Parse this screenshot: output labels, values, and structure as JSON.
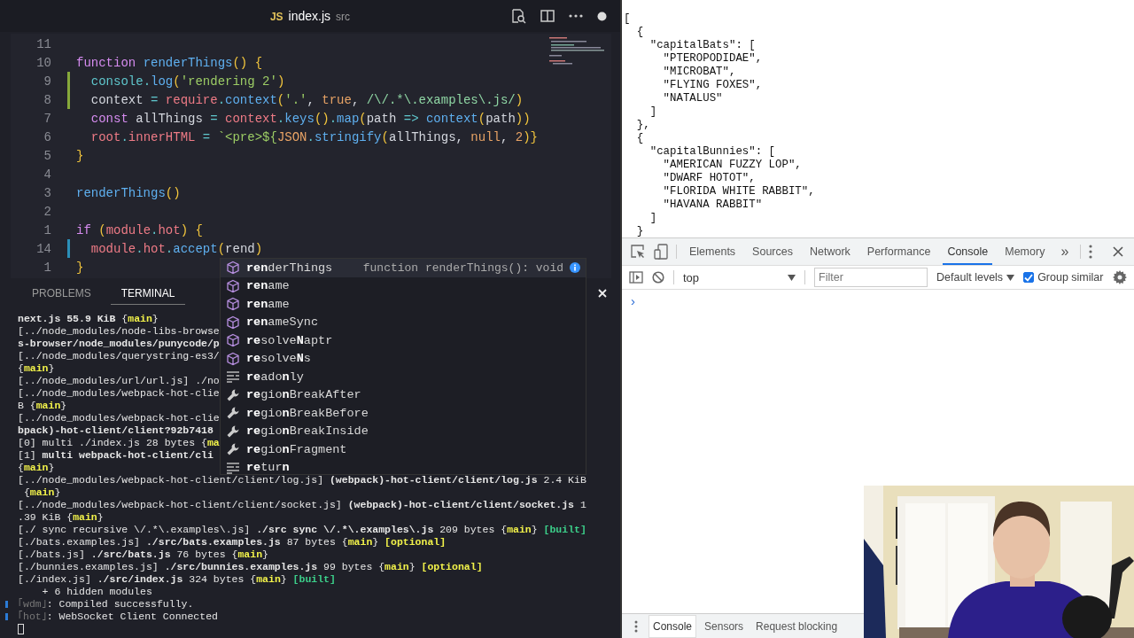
{
  "editor": {
    "tab": {
      "file_icon": "JS",
      "name": "index.js",
      "folder": "src",
      "unsaved": true
    },
    "lines": [
      {
        "number": "11"
      },
      {
        "number": "10",
        "tokens": [
          {
            "kind": "kw",
            "text": "function "
          },
          {
            "kind": "fn",
            "text": "renderThings"
          },
          {
            "kind": "pu",
            "text": "() {"
          }
        ]
      },
      {
        "number": "9",
        "color": "#86a83a",
        "tokens": [
          {
            "kind": "obj",
            "text": "  console"
          },
          {
            "kind": "op",
            "text": "."
          },
          {
            "kind": "me",
            "text": "log"
          },
          {
            "kind": "pu",
            "text": "("
          },
          {
            "kind": "st",
            "text": "'rendering 2'"
          },
          {
            "kind": "pu",
            "text": ")"
          }
        ]
      },
      {
        "number": "8",
        "color": "#86a83a",
        "tokens": [
          {
            "kind": "p",
            "text": "  context "
          },
          {
            "kind": "op",
            "text": "= "
          },
          {
            "kind": "rd",
            "text": "require"
          },
          {
            "kind": "op",
            "text": "."
          },
          {
            "kind": "me",
            "text": "context"
          },
          {
            "kind": "pu",
            "text": "("
          },
          {
            "kind": "st",
            "text": "'.'"
          },
          {
            "kind": "p",
            "text": ", "
          },
          {
            "kind": "nu",
            "text": "true"
          },
          {
            "kind": "p",
            "text": ", "
          },
          {
            "kind": "rx",
            "text": "/\\/.*\\.examples\\.js/"
          },
          {
            "kind": "pu",
            "text": ")"
          }
        ]
      },
      {
        "number": "7",
        "tokens": [
          {
            "kind": "kw",
            "text": "  const"
          },
          {
            "kind": "p",
            "text": " allThings "
          },
          {
            "kind": "op",
            "text": "= "
          },
          {
            "kind": "rd",
            "text": "context"
          },
          {
            "kind": "op",
            "text": "."
          },
          {
            "kind": "me",
            "text": "keys"
          },
          {
            "kind": "pu",
            "text": "()"
          },
          {
            "kind": "op",
            "text": "."
          },
          {
            "kind": "me",
            "text": "map"
          },
          {
            "kind": "pu",
            "text": "("
          },
          {
            "kind": "p",
            "text": "path "
          },
          {
            "kind": "op",
            "text": "=> "
          },
          {
            "kind": "me",
            "text": "context"
          },
          {
            "kind": "pu",
            "text": "("
          },
          {
            "kind": "p",
            "text": "path"
          },
          {
            "kind": "pu",
            "text": "))"
          }
        ]
      },
      {
        "number": "6",
        "tokens": [
          {
            "kind": "rd",
            "text": "  root"
          },
          {
            "kind": "op",
            "text": "."
          },
          {
            "kind": "rd",
            "text": "innerHTML "
          },
          {
            "kind": "op",
            "text": "= "
          },
          {
            "kind": "st",
            "text": "`<pre>${"
          },
          {
            "kind": "nu",
            "text": "JSON"
          },
          {
            "kind": "op",
            "text": "."
          },
          {
            "kind": "me",
            "text": "stringify"
          },
          {
            "kind": "pu",
            "text": "("
          },
          {
            "kind": "p",
            "text": "allThings, "
          },
          {
            "kind": "nu",
            "text": "null"
          },
          {
            "kind": "p",
            "text": ", "
          },
          {
            "kind": "nu",
            "text": "2"
          },
          {
            "kind": "pu",
            "text": ")}"
          }
        ]
      },
      {
        "number": "5",
        "tokens": [
          {
            "kind": "pu",
            "text": "}"
          }
        ]
      },
      {
        "number": "4"
      },
      {
        "number": "3",
        "tokens": [
          {
            "kind": "fn",
            "text": "renderThings"
          },
          {
            "kind": "pu",
            "text": "()"
          }
        ]
      },
      {
        "number": "2"
      },
      {
        "number": "1",
        "tokens": [
          {
            "kind": "kw",
            "text": "if "
          },
          {
            "kind": "pu",
            "text": "("
          },
          {
            "kind": "rd",
            "text": "module"
          },
          {
            "kind": "op",
            "text": "."
          },
          {
            "kind": "rd",
            "text": "hot"
          },
          {
            "kind": "pu",
            "text": ") {"
          }
        ]
      },
      {
        "number": "14",
        "color": "#2b8fb8",
        "tokens": [
          {
            "kind": "rd",
            "text": "  module"
          },
          {
            "kind": "op",
            "text": "."
          },
          {
            "kind": "rd",
            "text": "hot"
          },
          {
            "kind": "op",
            "text": "."
          },
          {
            "kind": "me",
            "text": "accept"
          },
          {
            "kind": "pu",
            "text": "("
          },
          {
            "kind": "p",
            "text": "rend"
          },
          {
            "kind": "pu",
            "text": ")"
          }
        ]
      },
      {
        "number": "1",
        "tokens": [
          {
            "kind": "pu",
            "text": "}"
          }
        ]
      }
    ],
    "suggestions": [
      {
        "kind": "method",
        "label": "**ren**derThings",
        "detail": "function renderThings(): void",
        "selected": true
      },
      {
        "kind": "method",
        "label": "**ren**ame",
        "selected": false
      },
      {
        "kind": "method",
        "label": "**ren**ame",
        "selected": false
      },
      {
        "kind": "method",
        "label": "**ren**ameSync",
        "selected": false
      },
      {
        "kind": "method",
        "label": "**re**solve**N**aptr",
        "selected": false
      },
      {
        "kind": "method",
        "label": "**re**solve**N**s",
        "selected": false
      },
      {
        "kind": "keyword",
        "label": "**re**ado**n**ly",
        "selected": false
      },
      {
        "kind": "property",
        "label": "**re**gio**n**BreakAfter",
        "selected": false
      },
      {
        "kind": "property",
        "label": "**re**gio**n**BreakBefore",
        "selected": false
      },
      {
        "kind": "property",
        "label": "**re**gio**n**BreakInside",
        "selected": false
      },
      {
        "kind": "property",
        "label": "**re**gio**n**Fragment",
        "selected": false
      },
      {
        "kind": "keyword",
        "label": "**re**tur**n**",
        "selected": false
      }
    ]
  },
  "panel": {
    "tabs": [
      {
        "label": "PROBLEMS",
        "selected": false
      },
      {
        "label": "TERMINAL",
        "selected": true
      }
    ],
    "terminal": [
      {
        "kind": "output",
        "segs": [
          {
            "kind": "b",
            "text": "next.js 55.9 KiB "
          },
          {
            "kind": "n",
            "text": "{"
          },
          {
            "kind": "y",
            "text": "main"
          },
          {
            "kind": "n",
            "text": "}"
          }
        ]
      },
      {
        "kind": "output",
        "segs": [
          {
            "kind": "n",
            "text": "[../node_modules/node-libs-browse"
          }
        ]
      },
      {
        "kind": "output",
        "segs": [
          {
            "kind": "b",
            "text": "s-browser/node_modules/punycode/p"
          }
        ]
      },
      {
        "kind": "output",
        "segs": [
          {
            "kind": "n",
            "text": "[../node_modules/querystring-es3/"
          }
        ]
      },
      {
        "kind": "output",
        "segs": [
          {
            "kind": "n",
            "text": "{"
          },
          {
            "kind": "y",
            "text": "main"
          },
          {
            "kind": "n",
            "text": "}"
          }
        ]
      },
      {
        "kind": "output",
        "segs": [
          {
            "kind": "n",
            "text": "[../node_modules/url/url.js] ./no"
          }
        ]
      },
      {
        "kind": "output",
        "segs": [
          {
            "kind": "n",
            "text": "[../node_modules/webpack-hot-clie"
          }
        ]
      },
      {
        "kind": "output",
        "segs": [
          {
            "kind": "n",
            "text": "B {"
          },
          {
            "kind": "y",
            "text": "main"
          },
          {
            "kind": "n",
            "text": "}"
          }
        ]
      },
      {
        "kind": "output",
        "segs": [
          {
            "kind": "n",
            "text": "[../node_modules/webpack-hot-clie"
          }
        ]
      },
      {
        "kind": "output",
        "segs": [
          {
            "kind": "b",
            "text": "bpack)-hot-client/client?92b7418"
          }
        ]
      },
      {
        "kind": "output",
        "segs": [
          {
            "kind": "n",
            "text": "[0] multi ./index.js 28 bytes {"
          },
          {
            "kind": "y",
            "text": "ma"
          }
        ]
      },
      {
        "kind": "output",
        "segs": [
          {
            "kind": "n",
            "text": "[1] "
          },
          {
            "kind": "b",
            "text": "multi webpack-hot-client/cli"
          }
        ]
      },
      {
        "kind": "output",
        "segs": [
          {
            "kind": "n",
            "text": "{"
          },
          {
            "kind": "y",
            "text": "main"
          },
          {
            "kind": "n",
            "text": "}"
          }
        ]
      },
      {
        "kind": "output",
        "segs": [
          {
            "kind": "n",
            "text": "[../node_modules/webpack-hot-client/client/log.js] "
          },
          {
            "kind": "b",
            "text": "(webpack)-hot-client/client/log.js"
          },
          {
            "kind": "n",
            "text": " 2.4 KiB"
          }
        ]
      },
      {
        "kind": "output",
        "segs": [
          {
            "kind": "n",
            "text": " {"
          },
          {
            "kind": "y",
            "text": "main"
          },
          {
            "kind": "n",
            "text": "}"
          }
        ]
      },
      {
        "kind": "output",
        "segs": [
          {
            "kind": "n",
            "text": "[../node_modules/webpack-hot-client/client/socket.js] "
          },
          {
            "kind": "b",
            "text": "(webpack)-hot-client/client/socket.js"
          },
          {
            "kind": "n",
            "text": " 1"
          }
        ]
      },
      {
        "kind": "output",
        "segs": [
          {
            "kind": "n",
            "text": ".39 KiB {"
          },
          {
            "kind": "y",
            "text": "main"
          },
          {
            "kind": "n",
            "text": "}"
          }
        ]
      },
      {
        "kind": "output",
        "segs": [
          {
            "kind": "n",
            "text": "[./ sync recursive \\/.*\\.examples\\.js] "
          },
          {
            "kind": "b",
            "text": "./src sync \\/.*\\.examples\\.js"
          },
          {
            "kind": "n",
            "text": " 209 bytes {"
          },
          {
            "kind": "y",
            "text": "main"
          },
          {
            "kind": "n",
            "text": "} "
          },
          {
            "kind": "g",
            "text": "[built]"
          }
        ]
      },
      {
        "kind": "output",
        "segs": [
          {
            "kind": "n",
            "text": "[./bats.examples.js] "
          },
          {
            "kind": "b",
            "text": "./src/bats.examples.js"
          },
          {
            "kind": "n",
            "text": " 87 bytes {"
          },
          {
            "kind": "y",
            "text": "main"
          },
          {
            "kind": "n",
            "text": "} "
          },
          {
            "kind": "o",
            "text": "[optional]"
          }
        ]
      },
      {
        "kind": "output",
        "segs": [
          {
            "kind": "n",
            "text": "[./bats.js] "
          },
          {
            "kind": "b",
            "text": "./src/bats.js"
          },
          {
            "kind": "n",
            "text": " 76 bytes {"
          },
          {
            "kind": "y",
            "text": "main"
          },
          {
            "kind": "n",
            "text": "}"
          }
        ]
      },
      {
        "kind": "output",
        "segs": [
          {
            "kind": "n",
            "text": "[./bunnies.examples.js] "
          },
          {
            "kind": "b",
            "text": "./src/bunnies.examples.js"
          },
          {
            "kind": "n",
            "text": " 99 bytes {"
          },
          {
            "kind": "y",
            "text": "main"
          },
          {
            "kind": "n",
            "text": "} "
          },
          {
            "kind": "o",
            "text": "[optional]"
          }
        ]
      },
      {
        "kind": "output",
        "segs": [
          {
            "kind": "n",
            "text": "[./index.js] "
          },
          {
            "kind": "b",
            "text": "./src/index.js"
          },
          {
            "kind": "n",
            "text": " 324 bytes {"
          },
          {
            "kind": "y",
            "text": "main"
          },
          {
            "kind": "n",
            "text": "} "
          },
          {
            "kind": "g",
            "text": "[built]"
          }
        ]
      },
      {
        "kind": "output",
        "segs": [
          {
            "kind": "n",
            "text": "    + 6 hidden modules"
          }
        ]
      },
      {
        "kind": "log",
        "segs": [
          {
            "kind": "d",
            "text": "｢wdm｣"
          },
          {
            "kind": "n",
            "text": ": Compiled successfully."
          }
        ]
      },
      {
        "kind": "log",
        "segs": [
          {
            "kind": "d",
            "text": "｢hot｣"
          },
          {
            "kind": "n",
            "text": ": WebSocket Client Connected"
          }
        ]
      }
    ]
  },
  "browser": {
    "output": [
      "[",
      "  {",
      "    \"capitalBats\": [",
      "      \"PTEROPODIDAE\",",
      "      \"MICROBAT\",",
      "      \"FLYING FOXES\",",
      "      \"NATALUS\"",
      "    ]",
      "  },",
      "  {",
      "    \"capitalBunnies\": [",
      "      \"AMERICAN FUZZY LOP\",",
      "      \"DWARF HOTOT\",",
      "      \"FLORIDA WHITE RABBIT\",",
      "      \"HAVANA RABBIT\"",
      "    ]",
      "  }"
    ]
  },
  "devtools": {
    "tabs": [
      {
        "label": "Elements",
        "selected": false
      },
      {
        "label": "Sources",
        "selected": false
      },
      {
        "label": "Network",
        "selected": false
      },
      {
        "label": "Performance",
        "selected": false
      },
      {
        "label": "Console",
        "selected": true
      },
      {
        "label": "Memory",
        "selected": false
      }
    ],
    "overflow": "»",
    "context": "top",
    "filter_placeholder": "Filter",
    "levels": "Default levels",
    "group_similar": {
      "label": "Group similar",
      "checked": true
    },
    "prompt": "›",
    "drawer_tabs": [
      {
        "label": "Console",
        "selected": true
      },
      {
        "label": "Sensors",
        "selected": false
      },
      {
        "label": "Request blocking",
        "selected": false
      }
    ]
  }
}
